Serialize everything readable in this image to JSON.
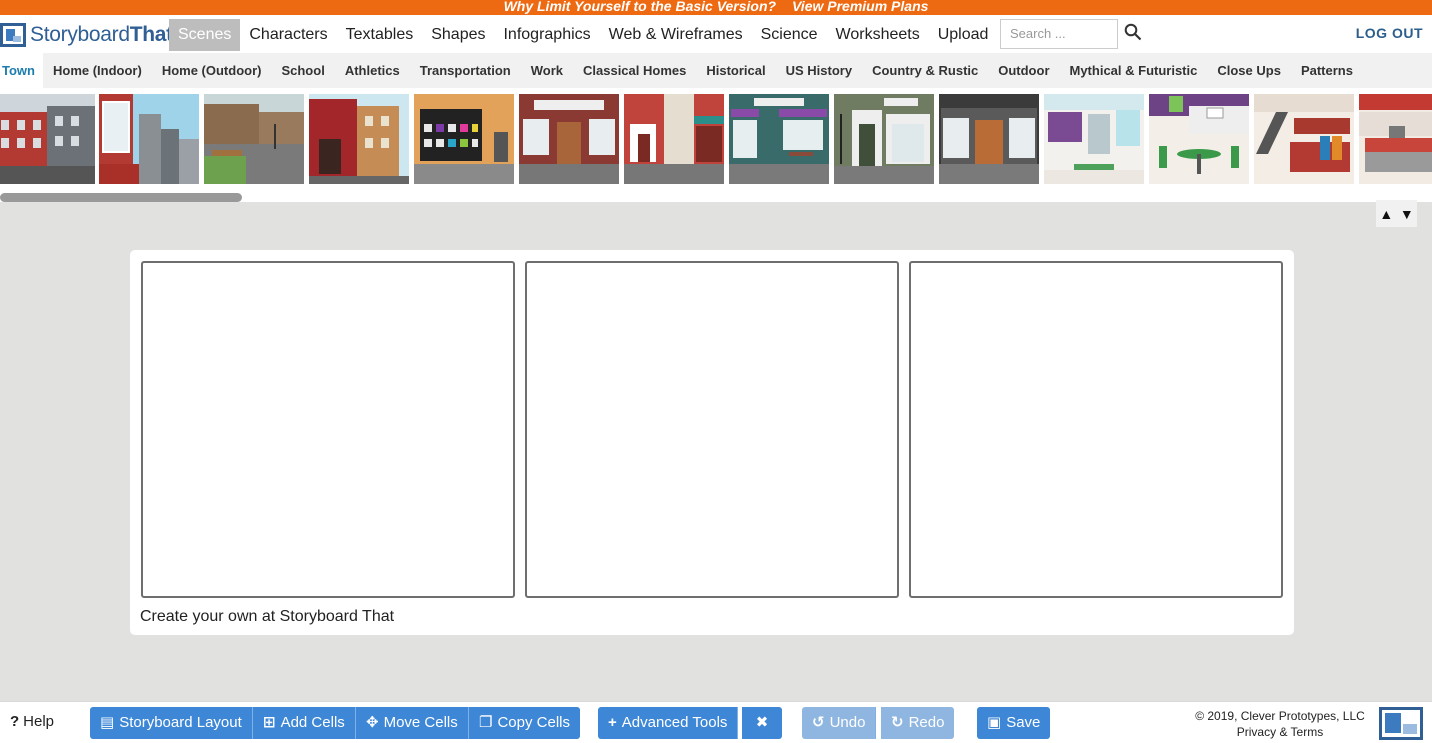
{
  "promo": {
    "text": "Why Limit Yourself to the Basic Version?",
    "link": "View Premium Plans"
  },
  "header": {
    "logo_prefix": "Storyboard",
    "logo_suffix": "That",
    "nav": [
      "Scenes",
      "Characters",
      "Textables",
      "Shapes",
      "Infographics",
      "Web & Wireframes",
      "Science",
      "Worksheets",
      "Upload"
    ],
    "active_nav": "Scenes",
    "search_placeholder": "Search ...",
    "logout": "LOG OUT"
  },
  "categories": [
    "Town",
    "Home (Indoor)",
    "Home (Outdoor)",
    "School",
    "Athletics",
    "Transportation",
    "Work",
    "Classical Homes",
    "Historical",
    "US History",
    "Country & Rustic",
    "Outdoor",
    "Mythical & Futuristic",
    "Close Ups",
    "Patterns"
  ],
  "active_category": "Town",
  "scene_thumbnails": [
    "brick-row-houses",
    "city-skyline-window",
    "city-park-bench",
    "red-brick-building",
    "community-bulletin-board",
    "storefront-brown-door",
    "red-storefront-awning",
    "purple-awning-cafe",
    "classic-white-storefront",
    "dark-storefront",
    "mall-interior-escalator",
    "food-court",
    "store-interior-escalator",
    "store-checkout"
  ],
  "sort_arrows": {
    "up": "▲",
    "down": "▼"
  },
  "storyboard": {
    "cell_count": 3,
    "caption": "Create your own at Storyboard That"
  },
  "toolbar": {
    "help": "Help",
    "storyboard_layout": "Storyboard Layout",
    "add_cells": "Add Cells",
    "move_cells": "Move Cells",
    "copy_cells": "Copy Cells",
    "advanced_tools": "Advanced Tools",
    "undo": "Undo",
    "redo": "Redo",
    "save": "Save",
    "copyright": "© 2019, Clever Prototypes, LLC",
    "privacy": "Privacy & Terms"
  },
  "colors": {
    "promo": "#ee6a12",
    "brand": "#2f5f95",
    "button": "#3d87d6",
    "active_category": "#1b7dad"
  }
}
